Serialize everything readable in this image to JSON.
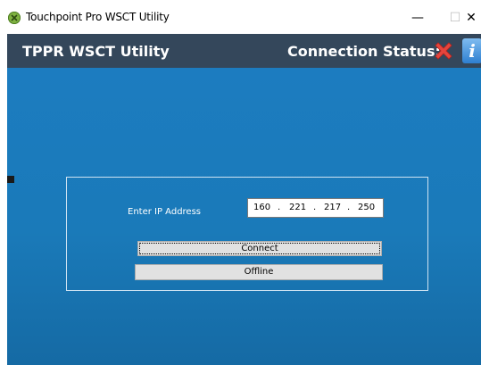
{
  "window": {
    "title": "Touchpoint Pro WSCT Utility",
    "icon": "touchpoint-app-icon",
    "controls": {
      "minimize": "—",
      "maximize": "☐",
      "close": "✕"
    }
  },
  "header": {
    "app_title": "TPPR WSCT Utility",
    "connection_label": "Connection Status:",
    "status_icon": "red-x-icon",
    "info_icon_text": "i",
    "colors": {
      "header_bg": "#34475b",
      "main_bg": "#1c7cc0",
      "status_red": "#e5453d"
    }
  },
  "form": {
    "ip_label": "Enter IP Address",
    "ip_octets": [
      "160",
      "221",
      "217",
      "250"
    ],
    "ip_separator": ".",
    "connect_label": "Connect",
    "offline_label": "Offline"
  }
}
